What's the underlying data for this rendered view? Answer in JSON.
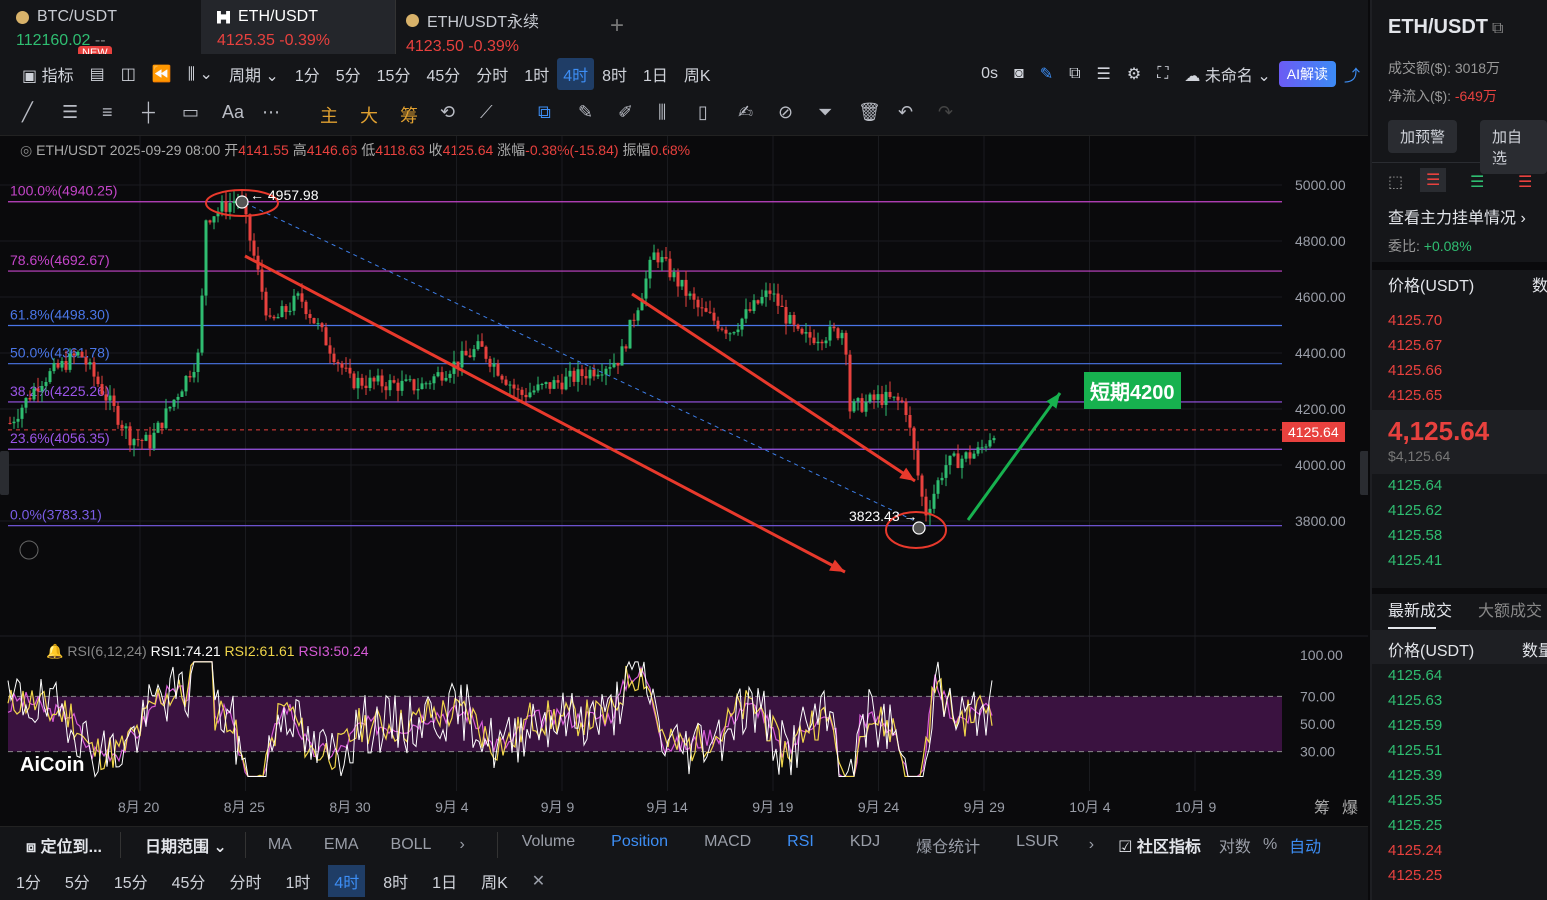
{
  "tabs": [
    {
      "name": "BTC/USDT",
      "price": "112160.02",
      "change": "--"
    },
    {
      "name": "ETH/USDT",
      "price": "4125.35",
      "change": "-0.39%"
    },
    {
      "name": "ETH/USDT永续",
      "price": "4123.50",
      "change": "-0.39%"
    }
  ],
  "new_badge": "NEW",
  "toolbar": {
    "indicator": "指标",
    "period": "周期",
    "intervals": [
      "1分",
      "5分",
      "15分",
      "45分",
      "分时",
      "1时",
      "4时",
      "8时",
      "1日",
      "周K"
    ],
    "active_interval": "4时",
    "timer": "0s",
    "unnamed": "未命名",
    "ai": "AI解读"
  },
  "toolbar2": {
    "text_tool": "Aa",
    "main": "主",
    "big": "大",
    "chips": "筹"
  },
  "ohlc": {
    "symbol": "ETH/USDT",
    "date": "2025-09-29 08:00",
    "open_label": "开",
    "open": "4141.55",
    "high_label": "高",
    "high": "4146.66",
    "low_label": "低",
    "low": "4118.63",
    "close_label": "收",
    "close": "4125.64",
    "chg_label": "涨幅",
    "chg": "-0.38%(-15.84)",
    "amp_label": "振幅",
    "amp": "0.68%"
  },
  "fib": [
    {
      "label": "100.0%(4940.25)",
      "color": "#c445c9",
      "price": 4940.25
    },
    {
      "label": "78.6%(4692.67)",
      "color": "#c445c9",
      "price": 4692.67
    },
    {
      "label": "61.8%(4498.30)",
      "color": "#4a76e8",
      "price": 4498.3
    },
    {
      "label": "50.0%(4361.78)",
      "color": "#4a76e8",
      "price": 4361.78
    },
    {
      "label": "38.2%(4225.26)",
      "color": "#9b55e8",
      "price": 4225.26
    },
    {
      "label": "23.6%(4056.35)",
      "color": "#9b55e8",
      "price": 4056.35
    },
    {
      "label": "0.0%(3783.31)",
      "color": "#7a5de8",
      "price": 3783.31
    }
  ],
  "price_axis": [
    "5000.00",
    "4800.00",
    "4600.00",
    "4400.00",
    "4200.00",
    "4000.00",
    "3800.00"
  ],
  "current_price_tag": "4125.64",
  "high_mark": "4957.98",
  "low_mark": "3823.43",
  "target_label": "短期4200",
  "rsi": {
    "title": "RSI(6,12,24)",
    "rsi1": "RSI1:74.21",
    "rsi2": "RSI2:61.61",
    "rsi3": "RSI3:50.24",
    "axis": [
      "100.00",
      "70.00",
      "50.00",
      "30.00"
    ]
  },
  "logo": "AiCoin",
  "dates": [
    "8月 20",
    "8月 25",
    "8月 30",
    "9月 4",
    "9月 9",
    "9月 14",
    "9月 19",
    "9月 24",
    "9月 29",
    "10月 4",
    "10月 9"
  ],
  "axis_right": [
    "筹",
    "爆"
  ],
  "right_panel": {
    "symbol": "ETH/USDT",
    "volume_label": "成交额($):",
    "volume": "3018万",
    "netflow_label": "净流入($):",
    "netflow": "-649万",
    "alert_btn": "加预警",
    "fav_btn": "加自选",
    "orders_title": "查看主力挂单情况",
    "ratio_label": "委比:",
    "ratio": "+0.08%",
    "price_col": "价格(USDT)",
    "qty_col": "数",
    "asks": [
      "4125.70",
      "4125.67",
      "4125.66",
      "4125.65"
    ],
    "last_price": "4,125.64",
    "last_price_usd": "$4,125.64",
    "bids": [
      "4125.64",
      "4125.62",
      "4125.58",
      "4125.41"
    ],
    "trades_tab": "最新成交",
    "big_trades_tab": "大额成交",
    "trades_price_col": "价格(USDT)",
    "trades_qty_col": "数量",
    "trades": [
      {
        "p": "4125.64",
        "c": "green"
      },
      {
        "p": "4125.63",
        "c": "green"
      },
      {
        "p": "4125.59",
        "c": "green"
      },
      {
        "p": "4125.51",
        "c": "green"
      },
      {
        "p": "4125.39",
        "c": "green"
      },
      {
        "p": "4125.35",
        "c": "green"
      },
      {
        "p": "4125.25",
        "c": "green"
      },
      {
        "p": "4125.24",
        "c": "red"
      },
      {
        "p": "4125.25",
        "c": "red"
      }
    ]
  },
  "bottom": {
    "locate": "定位到...",
    "date_range": "日期范围",
    "indicators": [
      "MA",
      "EMA",
      "BOLL"
    ],
    "sub_indicators": [
      "Volume",
      "Position",
      "MACD",
      "RSI",
      "KDJ",
      "爆仓统计",
      "LSUR"
    ],
    "active_sub": [
      "Position",
      "RSI"
    ],
    "community": "社区指标",
    "log": "对数",
    "pct": "%",
    "auto": "自动"
  },
  "bottom_intervals": [
    "1分",
    "5分",
    "15分",
    "45分",
    "分时",
    "1时",
    "4时",
    "8时",
    "1日",
    "周K"
  ]
}
